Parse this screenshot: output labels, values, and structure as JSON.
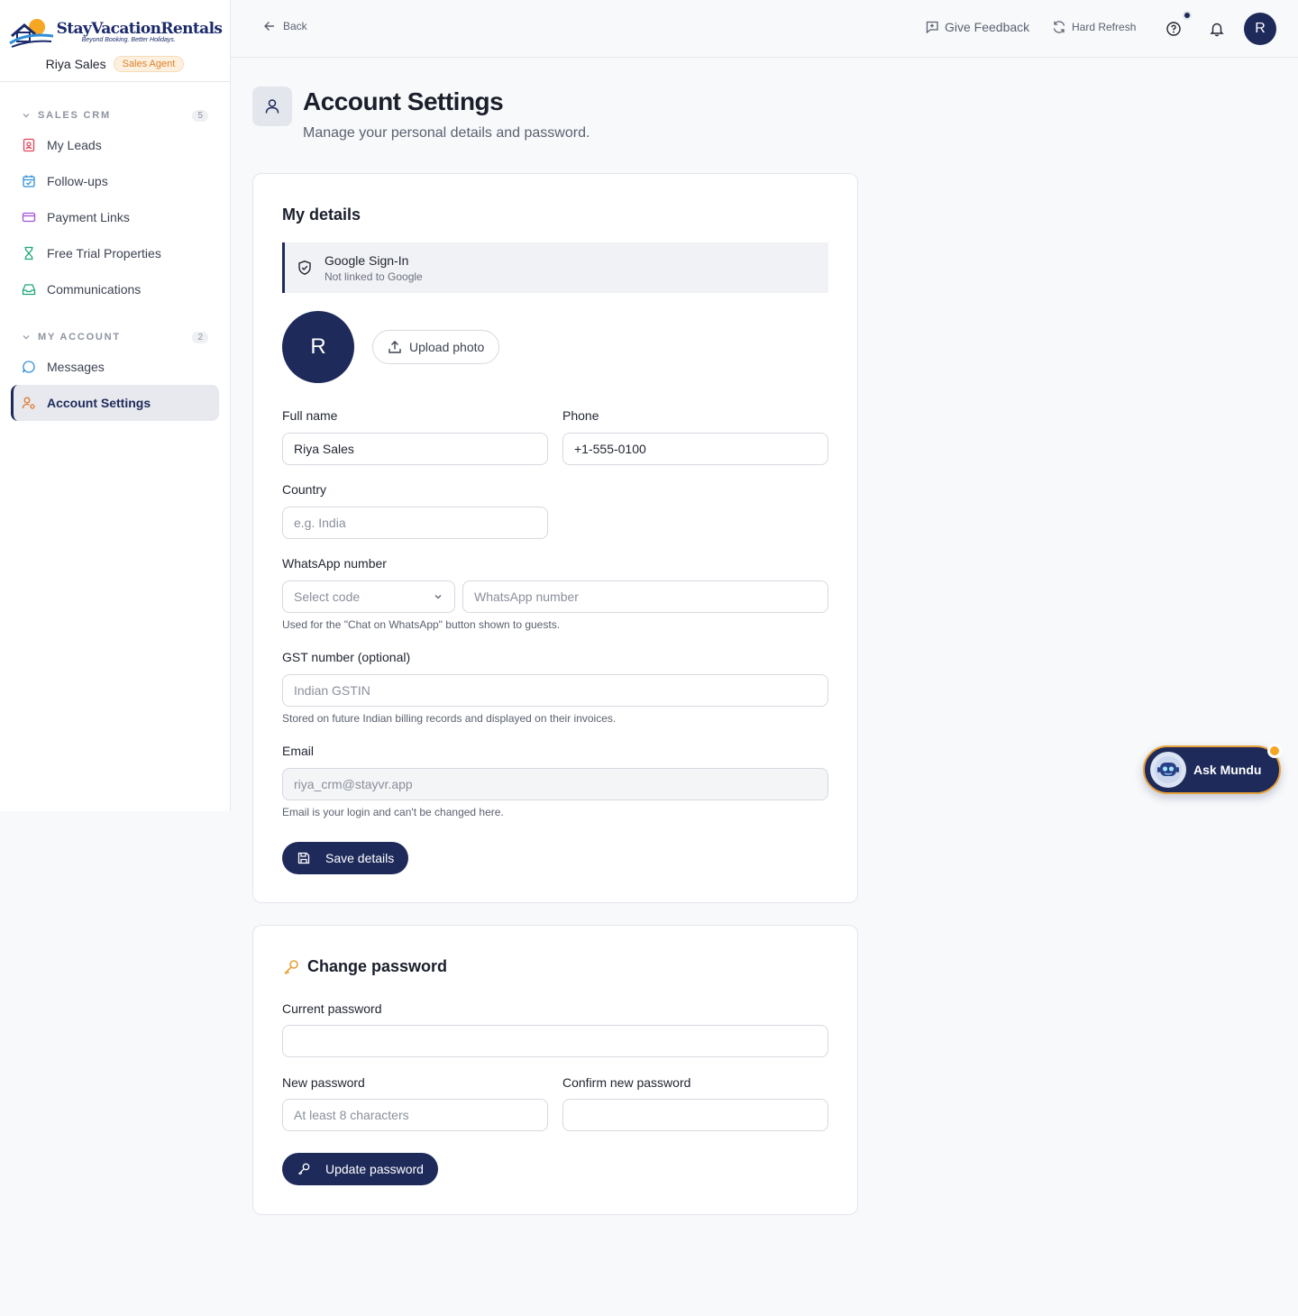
{
  "brand": {
    "logo_stay": "Stay",
    "logo_vacation": "VacationRentals",
    "logo_tagline": "Beyond Booking. Better Holidays.",
    "user_name": "Riya Sales",
    "role": "Sales Agent"
  },
  "sidebar": {
    "groups": [
      {
        "title": "SALES CRM",
        "count": "5",
        "items": [
          {
            "label": "My Leads",
            "icon": "contact-card-icon",
            "color": "#e0445a"
          },
          {
            "label": "Follow-ups",
            "icon": "calendar-check-icon",
            "color": "#2f8fd8"
          },
          {
            "label": "Payment Links",
            "icon": "credit-card-icon",
            "color": "#a155d6"
          },
          {
            "label": "Free Trial Properties",
            "icon": "hourglass-icon",
            "color": "#1fa67a"
          },
          {
            "label": "Communications",
            "icon": "inbox-icon",
            "color": "#1fa67a"
          }
        ]
      },
      {
        "title": "MY ACCOUNT",
        "count": "2",
        "items": [
          {
            "label": "Messages",
            "icon": "chat-bubble-icon",
            "color": "#2f8fd8"
          },
          {
            "label": "Account Settings",
            "icon": "user-cog-icon",
            "color": "#e07a2f",
            "active": true
          }
        ]
      }
    ]
  },
  "topbar": {
    "back_label": "Back",
    "feedback_label": "Give Feedback",
    "refresh_label": "Hard Refresh",
    "avatar_initial": "R"
  },
  "header": {
    "title": "Account Settings",
    "subtitle": "Manage your personal details and password."
  },
  "details": {
    "title": "My details",
    "google_title": "Google Sign-In",
    "google_status": "Not linked to Google",
    "avatar_initial": "R",
    "upload_label": "Upload photo",
    "full_name_label": "Full name",
    "full_name_value": "Riya Sales",
    "phone_label": "Phone",
    "phone_value": "+1-555-0100",
    "country_label": "Country",
    "country_placeholder": "e.g. India",
    "whatsapp_label": "WhatsApp number",
    "whatsapp_code_placeholder": "Select code",
    "whatsapp_number_placeholder": "WhatsApp number",
    "whatsapp_hint": "Used for the \"Chat on WhatsApp\" button shown to guests.",
    "gst_label": "GST number (optional)",
    "gst_placeholder": "Indian GSTIN",
    "gst_hint": "Stored on future Indian billing records and displayed on their invoices.",
    "email_label": "Email",
    "email_value": "riya_crm@stayvr.app",
    "email_hint": "Email is your login and can't be changed here.",
    "save_label": "Save details"
  },
  "password": {
    "title": "Change password",
    "current_label": "Current password",
    "new_label": "New password",
    "new_placeholder": "At least 8 characters",
    "confirm_label": "Confirm new password",
    "update_label": "Update password"
  },
  "assistant": {
    "label": "Ask Mundu"
  },
  "colors": {
    "primary": "#1e2a5a",
    "accent": "#f5a623"
  }
}
